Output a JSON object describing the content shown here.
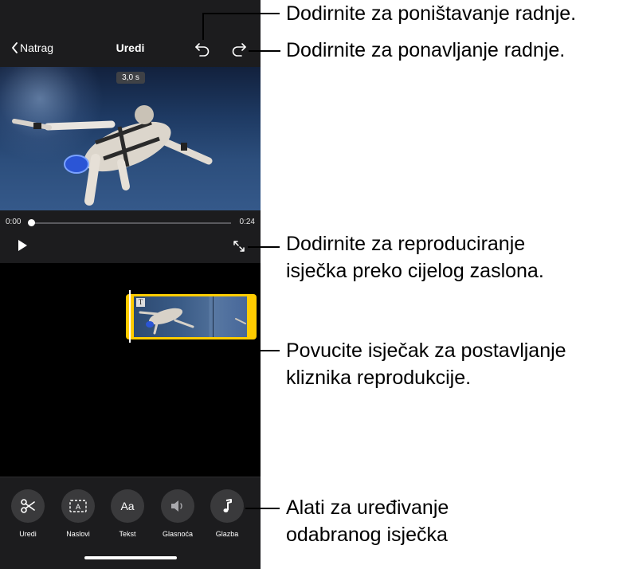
{
  "nav": {
    "back_label": "Natrag",
    "title": "Uredi"
  },
  "video": {
    "duration_badge": "3,0 s"
  },
  "playback": {
    "current_time": "0:00",
    "total_time": "0:24",
    "progress": 0.0
  },
  "tools": [
    {
      "label": "Uredi",
      "icon": "scissors-icon"
    },
    {
      "label": "Naslovi",
      "icon": "titles-icon"
    },
    {
      "label": "Tekst",
      "icon_text": "Aa",
      "icon": "text-icon"
    },
    {
      "label": "Glasnoća",
      "icon": "speaker-icon"
    },
    {
      "label": "Glazba",
      "icon": "music-note-icon"
    }
  ],
  "clip": {
    "text_badge": "T"
  },
  "callouts": {
    "undo": "Dodirnite za poništavanje radnje.",
    "redo": "Dodirnite za ponavljanje radnje.",
    "fullscreen_line1": "Dodirnite za reproduciranje",
    "fullscreen_line2": "isječka preko cijelog zaslona.",
    "drag_line1": "Povucite isječak za postavljanje",
    "drag_line2": "kliznika reprodukcije.",
    "tools_line1": "Alati za uređivanje",
    "tools_line2": "odabranog isječka"
  },
  "colors": {
    "clip_border": "#ffcc00",
    "background": "#000000",
    "bar": "#1c1c1e"
  }
}
